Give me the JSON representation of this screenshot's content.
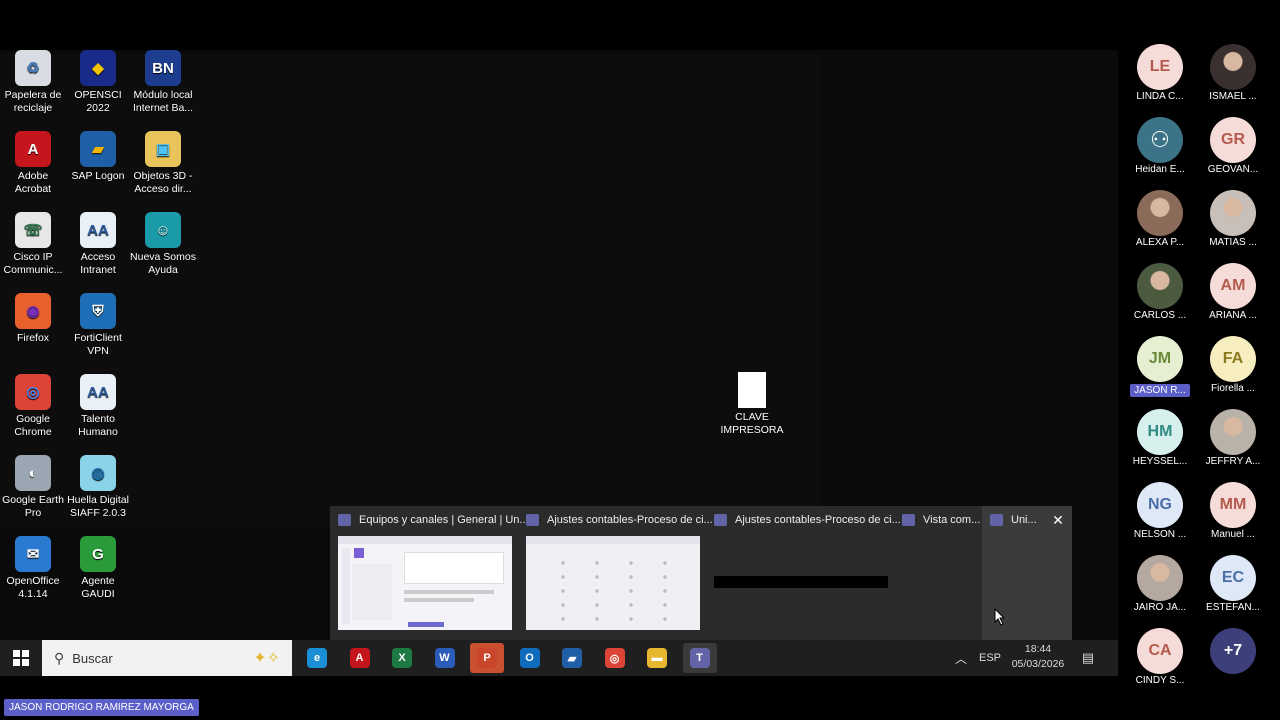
{
  "desktop": {
    "icons": [
      {
        "label": "Papelera de reciclaje",
        "glyph": "♻",
        "color": "#d9dde3",
        "fg": "#4a7ab5"
      },
      {
        "label": "OPENSCI 2022",
        "glyph": "◆",
        "color": "#1a2a8a",
        "fg": "#f5c400"
      },
      {
        "label": "Módulo local Internet Ba...",
        "glyph": "BN",
        "color": "#1d3d8f",
        "fg": "#ffffff"
      },
      {
        "label": "Adobe Acrobat",
        "glyph": "A",
        "color": "#c4161c",
        "fg": "#ffffff"
      },
      {
        "label": "SAP Logon",
        "glyph": "▰",
        "color": "#1f5fa8",
        "fg": "#f1b500"
      },
      {
        "label": "Objetos 3D - Acceso dir...",
        "glyph": "▣",
        "color": "#e8c45a",
        "fg": "#4fc3f7"
      },
      {
        "label": "Cisco IP Communic...",
        "glyph": "☏",
        "color": "#e7e7e7",
        "fg": "#2a7a4a"
      },
      {
        "label": "Acceso Intranet",
        "glyph": "AA",
        "color": "#e9f0f8",
        "fg": "#2b5c9a"
      },
      {
        "label": "Nueva Somos Ayuda",
        "glyph": "☺",
        "color": "#1b9aa8",
        "fg": "#ffffff"
      },
      {
        "label": "Firefox",
        "glyph": "◉",
        "color": "#e8602b",
        "fg": "#7b2fbf"
      },
      {
        "label": "FortiClient VPN",
        "glyph": "⛨",
        "color": "#1f6fb8",
        "fg": "#ffffff"
      },
      {
        "label": "Google Chrome",
        "glyph": "◎",
        "color": "#db4437",
        "fg": "#4285f4"
      },
      {
        "label": "Talento Humano",
        "glyph": "AA",
        "color": "#e9f0f8",
        "fg": "#2b5c9a"
      },
      {
        "label": "Google Earth Pro",
        "glyph": "◐",
        "color": "#9aa6b2",
        "fg": "#ffffff"
      },
      {
        "label": "Huella Digital SIAFF 2.0.3",
        "glyph": "◍",
        "color": "#8ad3e8",
        "fg": "#1b6ea8"
      },
      {
        "label": "OpenOffice 4.1.14",
        "glyph": "✉",
        "color": "#2a7ad2",
        "fg": "#ffffff"
      },
      {
        "label": "Agente GAUDI",
        "glyph": "G",
        "color": "#2b9a3a",
        "fg": "#ffffff"
      },
      {
        "label": "CLAVE IMPRESORA",
        "glyph": "",
        "color": "#ffffff",
        "fg": "#000000"
      }
    ]
  },
  "taskbar": {
    "search_placeholder": "Buscar",
    "apps": [
      {
        "name": "edge",
        "glyph": "e",
        "color": "#1b8fd6"
      },
      {
        "name": "acrobat",
        "glyph": "A",
        "color": "#c4161c"
      },
      {
        "name": "excel",
        "glyph": "X",
        "color": "#1d7a43"
      },
      {
        "name": "word",
        "glyph": "W",
        "color": "#2b5cb8"
      },
      {
        "name": "powerpoint",
        "glyph": "P",
        "color": "#c9452b"
      },
      {
        "name": "outlook",
        "glyph": "O",
        "color": "#0f6cbd"
      },
      {
        "name": "sap",
        "glyph": "▰",
        "color": "#1f5fa8"
      },
      {
        "name": "chrome",
        "glyph": "◎",
        "color": "#db4437"
      },
      {
        "name": "explorer",
        "glyph": "▬",
        "color": "#e8b730"
      },
      {
        "name": "teams",
        "glyph": "T",
        "color": "#6264a7"
      }
    ],
    "language": "ESP",
    "time": "18:44",
    "date": "05/03/2026"
  },
  "thumbnails": [
    {
      "title": "Equipos y canales | General | Un..."
    },
    {
      "title": "Ajustes contables-Proceso de ci..."
    },
    {
      "title": "Ajustes contables-Proceso de ci..."
    },
    {
      "title": "Vista com..."
    },
    {
      "title": "Uni..."
    }
  ],
  "participants": [
    {
      "initials": "LE",
      "name": "LINDA C...",
      "bg": "#f6dcd8",
      "fg": "#b45a4e",
      "photo": false
    },
    {
      "initials": "",
      "name": "ISMAEL ...",
      "bg": "#3a3030",
      "fg": "#ffffff",
      "photo": true
    },
    {
      "initials": "",
      "name": "Heidan E...",
      "bg": "#3d7388",
      "fg": "#ffffff",
      "photo": false,
      "icon": true
    },
    {
      "initials": "GR",
      "name": "GEOVAN...",
      "bg": "#f6dcd8",
      "fg": "#b45a4e",
      "photo": false
    },
    {
      "initials": "",
      "name": "ALEXA P...",
      "bg": "#8a6a58",
      "fg": "#ffffff",
      "photo": true
    },
    {
      "initials": "",
      "name": "MATIAS ...",
      "bg": "#c8c0b8",
      "fg": "#ffffff",
      "photo": true
    },
    {
      "initials": "",
      "name": "CARLOS ...",
      "bg": "#4c5a40",
      "fg": "#ffffff",
      "photo": true
    },
    {
      "initials": "AM",
      "name": "ARIANA ...",
      "bg": "#f6dcd8",
      "fg": "#b45a4e",
      "photo": false
    },
    {
      "initials": "JM",
      "name": "JASON R...",
      "bg": "#e6efd2",
      "fg": "#6b8a3a",
      "photo": false,
      "highlight": true
    },
    {
      "initials": "FA",
      "name": "Fiorella ...",
      "bg": "#f7eec0",
      "fg": "#8a7a20",
      "photo": false
    },
    {
      "initials": "HM",
      "name": "HEYSSEL...",
      "bg": "#d7f0ee",
      "fg": "#2f8a82",
      "photo": false
    },
    {
      "initials": "",
      "name": "JEFFRY A...",
      "bg": "#b8b2a8",
      "fg": "#ffffff",
      "photo": true
    },
    {
      "initials": "NG",
      "name": "NELSON ...",
      "bg": "#dfe8f6",
      "fg": "#4c6ea8",
      "photo": false
    },
    {
      "initials": "MM",
      "name": "Manuel ...",
      "bg": "#f6dcd8",
      "fg": "#b45a4e",
      "photo": false
    },
    {
      "initials": "",
      "name": "JAIRO JA...",
      "bg": "#b4a8a0",
      "fg": "#ffffff",
      "photo": true
    },
    {
      "initials": "EC",
      "name": "ESTEFAN...",
      "bg": "#dfe8f6",
      "fg": "#4c6ea8",
      "photo": false
    },
    {
      "initials": "CA",
      "name": "CINDY S...",
      "bg": "#f6dcd8",
      "fg": "#b45a4e",
      "photo": false
    },
    {
      "initials": "+7",
      "name": "",
      "bg": "#3d3f7a",
      "fg": "#ffffff",
      "photo": false
    }
  ],
  "speaker": "JASON RODRIGO RAMIREZ MAYORGA"
}
